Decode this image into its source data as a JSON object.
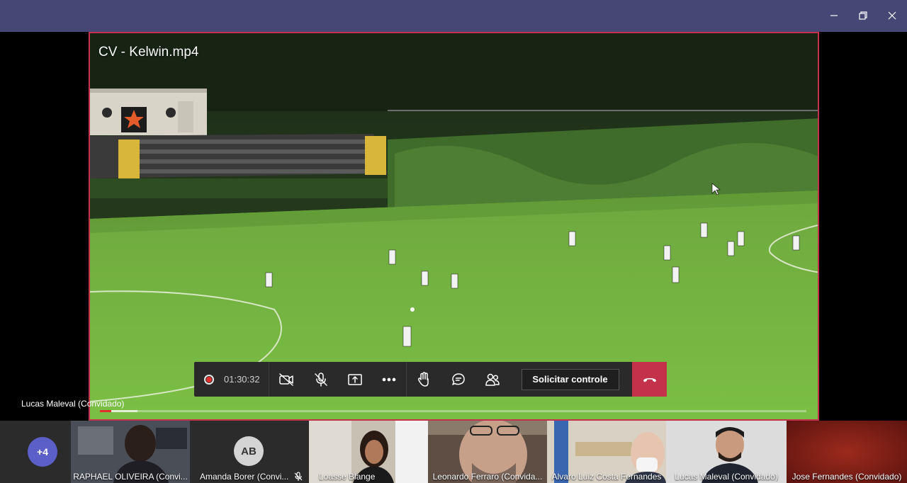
{
  "window": {
    "controls": [
      "minimize",
      "restore",
      "close"
    ]
  },
  "share": {
    "title": "CV - Kelwin.mp4",
    "presenter": "Lucas Maleval (Convidado)",
    "progress": {
      "played_fraction": 0.016,
      "buffered_fraction": 0.053
    }
  },
  "controls": {
    "recording_time": "01:30:32",
    "request_control_label": "Solicitar controle",
    "icons": [
      "camera-off-icon",
      "mic-off-icon",
      "share-tray-icon",
      "more-options-icon",
      "raise-hand-icon",
      "chat-icon",
      "participants-icon",
      "hang-up-icon"
    ]
  },
  "participants": {
    "overflow": "+4",
    "tiles": [
      {
        "name": "RAPHAEL OLIVEIRA (Convi...",
        "type": "video",
        "bg": "#3b3f48"
      },
      {
        "name": "Amanda Borer (Convi...",
        "type": "avatar",
        "initials": "AB",
        "muted": true
      },
      {
        "name": "Loasse Blange",
        "type": "video",
        "bg": "#b8b0a4"
      },
      {
        "name": "Leonardo Ferraro (Convida...",
        "type": "video",
        "bg": "#7a6a5e"
      },
      {
        "name": "Alvaro Luiz Costa Fernandes",
        "type": "video",
        "bg": "#c9c2b4"
      },
      {
        "name": "Lucas Maleval (Convidado)",
        "type": "video",
        "bg": "#d8d8d8"
      },
      {
        "name": "Jose Fernandes (Convidado)",
        "type": "video",
        "bg": "#8c1f16"
      }
    ]
  },
  "colors": {
    "titlebar": "#464775",
    "hangup": "#c4314b",
    "share_border": "#c4314b",
    "accent": "#5b5fc7"
  }
}
